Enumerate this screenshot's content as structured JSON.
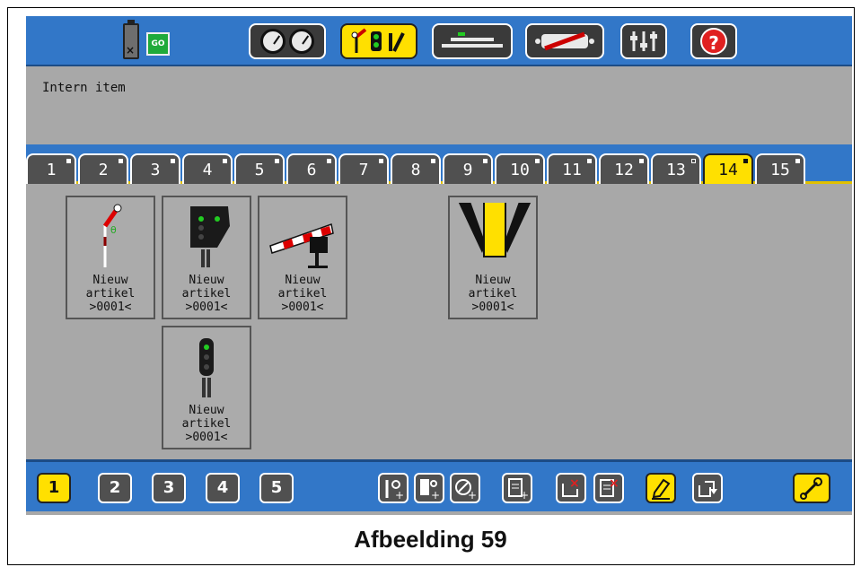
{
  "status": {
    "battery_mark": "×",
    "go_label": "GO"
  },
  "top_buttons": [
    {
      "name": "gauges",
      "active": false
    },
    {
      "name": "accessories",
      "active": true
    },
    {
      "name": "track",
      "active": false
    },
    {
      "name": "locomotive",
      "active": false
    },
    {
      "name": "settings",
      "active": false
    },
    {
      "name": "help",
      "active": false,
      "text": "?"
    }
  ],
  "info": {
    "text": "Intern item"
  },
  "tabs": [
    {
      "label": "1",
      "active": false
    },
    {
      "label": "2",
      "active": false
    },
    {
      "label": "3",
      "active": false
    },
    {
      "label": "4",
      "active": false
    },
    {
      "label": "5",
      "active": false
    },
    {
      "label": "6",
      "active": false
    },
    {
      "label": "7",
      "active": false
    },
    {
      "label": "8",
      "active": false
    },
    {
      "label": "9",
      "active": false
    },
    {
      "label": "10",
      "active": false
    },
    {
      "label": "11",
      "active": false
    },
    {
      "label": "12",
      "active": false
    },
    {
      "label": "13",
      "active": false,
      "hollow": true
    },
    {
      "label": "14",
      "active": true
    },
    {
      "label": "15",
      "active": false
    }
  ],
  "items": [
    {
      "type": "semaphore-signal",
      "line1": "Nieuw",
      "line2": "artikel",
      "line3": ">0001<"
    },
    {
      "type": "light-signal-wide",
      "line1": "Nieuw",
      "line2": "artikel",
      "line3": ">0001<"
    },
    {
      "type": "barrier-gate",
      "line1": "Nieuw",
      "line2": "artikel",
      "line3": ">0001<"
    },
    {
      "type": "turnout",
      "line1": "Nieuw",
      "line2": "artikel",
      "line3": ">0001<"
    },
    {
      "type": "light-signal",
      "line1": "Nieuw",
      "line2": "artikel",
      "line3": ">0001<"
    }
  ],
  "pages": [
    {
      "label": "1",
      "active": true
    },
    {
      "label": "2",
      "active": false
    },
    {
      "label": "3",
      "active": false
    },
    {
      "label": "4",
      "active": false
    },
    {
      "label": "5",
      "active": false
    }
  ],
  "tools": [
    "add-signal-icon",
    "add-route-icon",
    "add-accessory-icon",
    "add-list-icon",
    "delete-item-icon",
    "delete-list-icon",
    "edit-icon",
    "move-icon",
    "wrench-icon"
  ],
  "caption": "Afbeelding 59",
  "colors": {
    "bar_blue": "#3277c8",
    "active_yellow": "#ffe000",
    "panel_gray": "#a8a8a8"
  }
}
